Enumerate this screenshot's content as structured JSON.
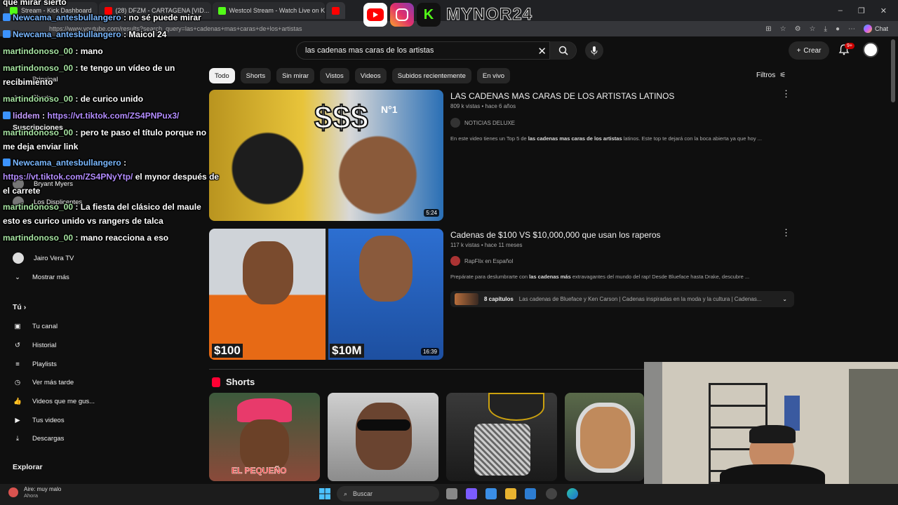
{
  "browser": {
    "tabs": [
      {
        "title": "Stream - Kick Dashboard",
        "fav": "k"
      },
      {
        "title": "(28) DFZM - CARTAGENA [VID...",
        "fav": "yt"
      },
      {
        "title": "Westcol Stream - Watch Live on Ki...",
        "fav": "k"
      },
      {
        "title": "",
        "fav": "yt"
      }
    ],
    "url": "https://www.youtube.com/results?search_query=las+cadenas+mas+caras+de+los+artistas",
    "copilot_label": "Chat"
  },
  "youtube": {
    "search_value": "las cadenas mas caras de los artistas",
    "create_label": "Crear",
    "notif_count": "9+",
    "chips": [
      "Todo",
      "Shorts",
      "Sin mirar",
      "Vistos",
      "Videos",
      "Subidos recientemente",
      "En vivo"
    ],
    "filters_label": "Filtros",
    "results": [
      {
        "title": "LAS CADENAS MAS CARAS DE LOS ARTISTAS LATINOS",
        "meta": "809 k vistas • hace 6 años",
        "channel": "NOTICIAS DELUXE",
        "desc_pre": "En este video tienes un Top 5 de ",
        "desc_bold": "las cadenas mas caras de los artistas",
        "desc_post": " latinos. Este top te dejará con la boca abierta ya que hoy ...",
        "duration": "5:24",
        "thumb_text_1": "$$$",
        "thumb_text_2": "N°1"
      },
      {
        "title": "Cadenas de $100 VS $10,000,000 que usan los raperos",
        "meta": "117 k vistas • hace 11 meses",
        "channel": "RapFlix en Español",
        "desc_pre": "Prepárate para deslumbrarte con ",
        "desc_bold": "las cadenas más",
        "desc_post": " extravagantes del mundo del rap! Desde Blueface hasta Drake, descubre ...",
        "duration": "16:39",
        "thumb_text_1": "$100",
        "thumb_text_2": "$10M",
        "chapters_count": "8 capítulos",
        "chapters_text": "Las cadenas de Blueface y Ken Carson | Cadenas inspiradas en la moda y la cultura | Cadenas..."
      }
    ],
    "shorts_heading": "Shorts",
    "short_caption": "EL PEQUEÑO",
    "sidebar": {
      "principal": "Principal",
      "shorts": "Shorts",
      "suscripciones": "Suscripciones",
      "subs": [
        "Bryant Myers",
        "Los Displicentes",
        "Jairo Vera TV"
      ],
      "mostrar_mas": "Mostrar más",
      "tu": "Tú",
      "tu_items": [
        "Tu canal",
        "Historial",
        "Playlists",
        "Ver más tarde",
        "Videos que me gus...",
        "Tus videos",
        "Descargas"
      ],
      "explorar": "Explorar"
    }
  },
  "chat": [
    {
      "user": "",
      "text": "que mirar sierto",
      "ucls": "",
      "badge": false
    },
    {
      "user": "Newcama_antesbullangero",
      "text": ": no sé puede mirar",
      "ucls": "u2",
      "badge": true
    },
    {
      "user": "Newcama_antesbullangero",
      "text": ": Maicol 24",
      "ucls": "u2",
      "badge": true
    },
    {
      "user": "martindonoso_00",
      "text": ": mano",
      "ucls": "u1",
      "badge": false
    },
    {
      "user": "martindonoso_00",
      "text": ": te tengo un vídeo de un",
      "ucls": "u1",
      "badge": false
    },
    {
      "user": "",
      "text": "recibimiento",
      "ucls": "",
      "badge": false
    },
    {
      "user": "martindonoso_00",
      "text": ": de curico unido",
      "ucls": "u1",
      "badge": false
    },
    {
      "user": "liddem",
      "text": ": ",
      "link": "https://vt.tiktok.com/ZS4PNPux3/",
      "ucls": "u3",
      "badge": true
    },
    {
      "user": "martindonoso_00",
      "text": ": pero te paso el título porque no",
      "ucls": "u1",
      "badge": false
    },
    {
      "user": "",
      "text": "me deja enviar link",
      "ucls": "",
      "badge": false
    },
    {
      "user": "Newcama_antesbullangero",
      "text": ":",
      "ucls": "u2",
      "badge": true
    },
    {
      "user": "",
      "text": " el mynor después de",
      "link": "https://vt.tiktok.com/ZS4PNyYtp/",
      "ucls": "",
      "badge": false
    },
    {
      "user": "",
      "text": "el carrete",
      "ucls": "",
      "badge": false
    },
    {
      "user": "martindonoso_00",
      "text": ": La fiesta del clásico del maule",
      "ucls": "u1",
      "badge": false
    },
    {
      "user": "",
      "text": "esto es curico unido vs rangers de talca",
      "ucls": "",
      "badge": false
    },
    {
      "user": "martindonoso_00",
      "text": ": mano reacciona a eso",
      "ucls": "u1",
      "badge": false
    }
  ],
  "overlay": {
    "streamer_name": "MYNOR24",
    "kick_letter": "K"
  },
  "taskbar": {
    "weather_title": "Aire: muy malo",
    "weather_sub": "Ahora",
    "search_label": "Buscar"
  },
  "colors": {
    "yt_bg": "#0f0f0f",
    "chip_bg": "#272727",
    "kick_green": "#53fc18",
    "yt_red": "#ff0000"
  }
}
